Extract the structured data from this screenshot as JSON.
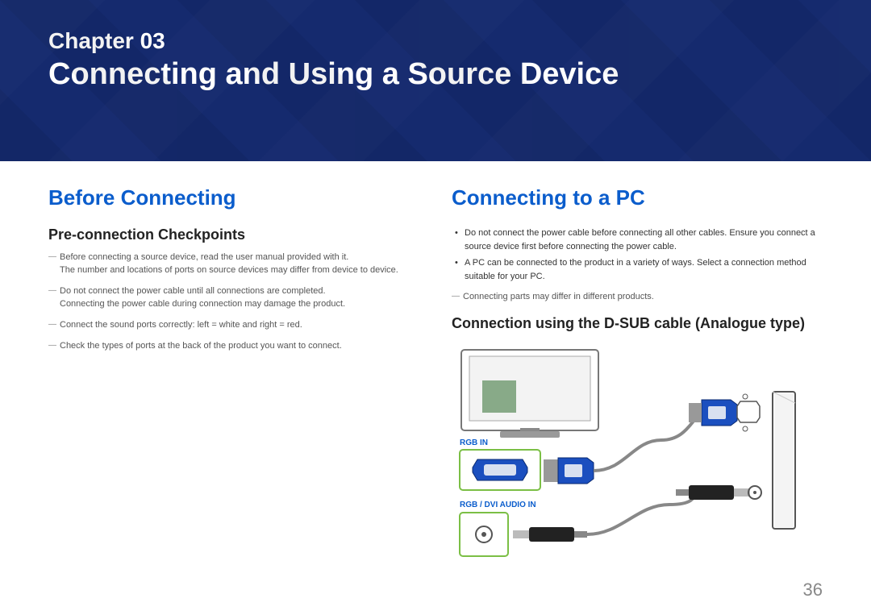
{
  "header": {
    "chapter_label": "Chapter  03",
    "chapter_title": "Connecting and Using a Source Device"
  },
  "page_number": "36",
  "left": {
    "heading": "Before Connecting",
    "sub": "Pre-connection Checkpoints",
    "items": [
      {
        "l1": "Before connecting a source device, read the user manual provided with it.",
        "l2": "The number and locations of ports on source devices may differ from device to device."
      },
      {
        "l1": "Do not connect the power cable until all connections are completed.",
        "l2": "Connecting the power cable during connection may damage the product."
      },
      {
        "l1": "Connect the sound ports correctly: left = white and right = red."
      },
      {
        "l1": "Check the types of ports at the back of the product you want to connect."
      }
    ]
  },
  "right": {
    "heading": "Connecting to a PC",
    "bullets": [
      {
        "l1": "Do not connect the power cable before connecting all other cables.",
        "l2": "Ensure you connect a source device first before connecting the power cable."
      },
      {
        "l1": "A PC can be connected to the product in a variety of ways.",
        "l2": "Select a connection method suitable for your PC."
      }
    ],
    "dash_note": "Connecting parts may differ in different products.",
    "sub2": "Connection using the D-SUB cable (Analogue type)",
    "labels": {
      "rgb_in": "RGB IN",
      "rgb_audio": "RGB / DVI AUDIO IN"
    }
  }
}
